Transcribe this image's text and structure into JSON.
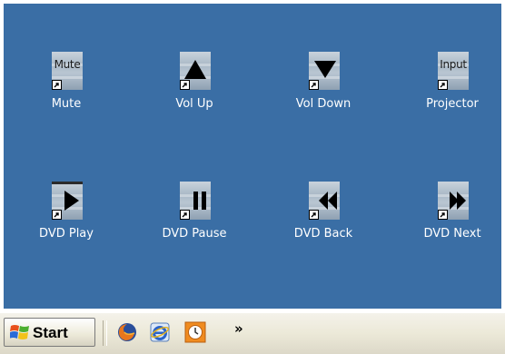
{
  "desktop": {
    "background_color": "#3a6ea5",
    "shortcuts": [
      {
        "label": "Mute",
        "tile_text": "Mute",
        "icon": "mute-icon"
      },
      {
        "label": "Vol Up",
        "tile_text": "",
        "icon": "volume-up-icon"
      },
      {
        "label": "Vol Down",
        "tile_text": "",
        "icon": "volume-down-icon"
      },
      {
        "label": "Projector",
        "tile_text": "Input",
        "icon": "projector-input-icon"
      },
      {
        "label": "DVD Play",
        "tile_text": "",
        "icon": "play-icon"
      },
      {
        "label": "DVD Pause",
        "tile_text": "",
        "icon": "pause-icon"
      },
      {
        "label": "DVD Back",
        "tile_text": "",
        "icon": "rewind-icon"
      },
      {
        "label": "DVD Next",
        "tile_text": "",
        "icon": "fast-forward-icon"
      }
    ]
  },
  "taskbar": {
    "start_label": "Start",
    "quick_launch": [
      {
        "icon": "firefox-icon"
      },
      {
        "icon": "internet-explorer-icon"
      },
      {
        "icon": "clock-icon"
      }
    ],
    "overflow_label": "»"
  }
}
